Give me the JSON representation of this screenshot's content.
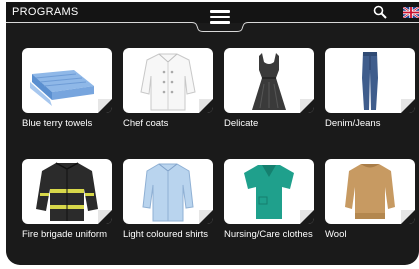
{
  "header": {
    "title": "PROGRAMS",
    "menu_icon": "hamburger-menu-icon",
    "search_icon": "search-icon",
    "language_icon": "uk-flag-icon"
  },
  "programs": [
    {
      "label": "Blue terry towels",
      "icon": "towels-icon"
    },
    {
      "label": "Chef coats",
      "icon": "chef-coat-icon"
    },
    {
      "label": "Delicate",
      "icon": "dress-icon"
    },
    {
      "label": "Denim/Jeans",
      "icon": "jeans-icon"
    },
    {
      "label": "Fire brigade uniform",
      "icon": "fire-jacket-icon"
    },
    {
      "label": "Light coloured shirts",
      "icon": "shirt-icon"
    },
    {
      "label": "Nursing/Care clothes",
      "icon": "scrubs-icon"
    },
    {
      "label": "Wool",
      "icon": "sweater-icon"
    }
  ],
  "colors": {
    "background": "#1a1a1a",
    "tile": "#ffffff",
    "text": "#ffffff"
  }
}
